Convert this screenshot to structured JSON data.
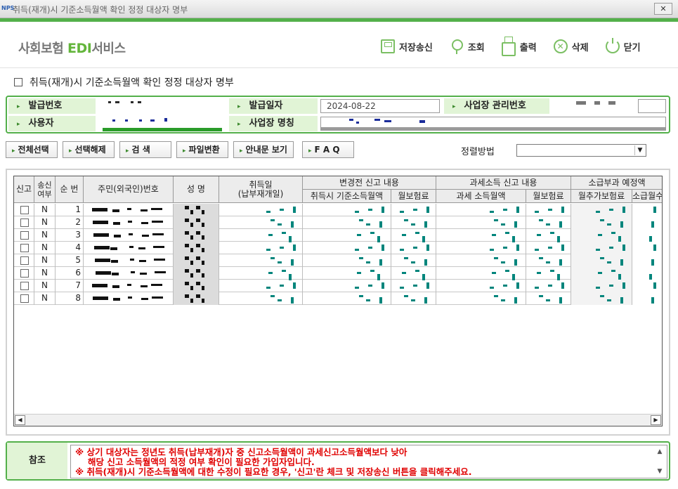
{
  "window": {
    "app_badge": "NPS",
    "title": "취득(재개)시 기준소득월액 확인 정정 대상자 명부",
    "close_label": "✕"
  },
  "header": {
    "brand_prefix": "사회보험 ",
    "brand_edi": "EDI",
    "brand_suffix": "서비스",
    "toolbar": {
      "save_send": "저장송신",
      "search": "조회",
      "print": "출력",
      "delete": "삭제",
      "close": "닫기"
    }
  },
  "section_title": "취득(재개)시 기준소득월액 확인 정정 대상자 명부",
  "info": {
    "issue_no_label": "발급번호",
    "issue_date_label": "발급일자",
    "issue_date_value": "2024-08-22",
    "biz_mgmt_no_label": "사업장 관리번호",
    "user_label": "사용자",
    "biz_name_label": "사업장 명칭"
  },
  "actions": {
    "select_all": "전체선택",
    "deselect": "선택해제",
    "search": "검   색",
    "file_convert": "파일변환",
    "guide_view": "안내문 보기",
    "faq": "F A Q",
    "sort_label": "정렬방법",
    "sort_value": ""
  },
  "grid": {
    "headers": {
      "report": "신고",
      "send_yn": "송신여부",
      "seq": "순 번",
      "resident_no": "주민(외국인)번호",
      "name": "성 명",
      "acq_date": "취득일",
      "acq_date_sub": "(납부재개일)",
      "before_group": "변경전 신고 내용",
      "before_base_income": "취득시 기준소득월액",
      "before_premium": "월보험료",
      "tax_group": "과세소득 신고 내용",
      "tax_income": "과세 소득월액",
      "tax_premium": "월보험료",
      "retro_group": "소급부과 예정액",
      "retro_add": "월추가보험료",
      "retro_months": "소급월수"
    },
    "rows": [
      {
        "send_yn": "N",
        "seq": "1"
      },
      {
        "send_yn": "N",
        "seq": "2"
      },
      {
        "send_yn": "N",
        "seq": "3"
      },
      {
        "send_yn": "N",
        "seq": "4"
      },
      {
        "send_yn": "N",
        "seq": "5"
      },
      {
        "send_yn": "N",
        "seq": "6"
      },
      {
        "send_yn": "N",
        "seq": "7"
      },
      {
        "send_yn": "N",
        "seq": "8"
      }
    ]
  },
  "reference": {
    "label": "참조",
    "line1": "※ 상기 대상자는 정년도 취득(납부재개)자 중 신고소득월액이 과세신고소득월액보다 낮아",
    "line2": "해당 신고 소득월액의 적정 여부 확인이 필요한 가입자입니다.",
    "line3": "※ 취득(재개)시 기준소득월액에 대한 수정이 필요한 경우, '신고'란 체크 및 저장송신 버튼을 클릭해주세요."
  },
  "colors": {
    "accent_green": "#53b04a",
    "label_bg": "#e1f4d6",
    "notice_red": "#e00000",
    "masked_teal": "#00857c"
  }
}
